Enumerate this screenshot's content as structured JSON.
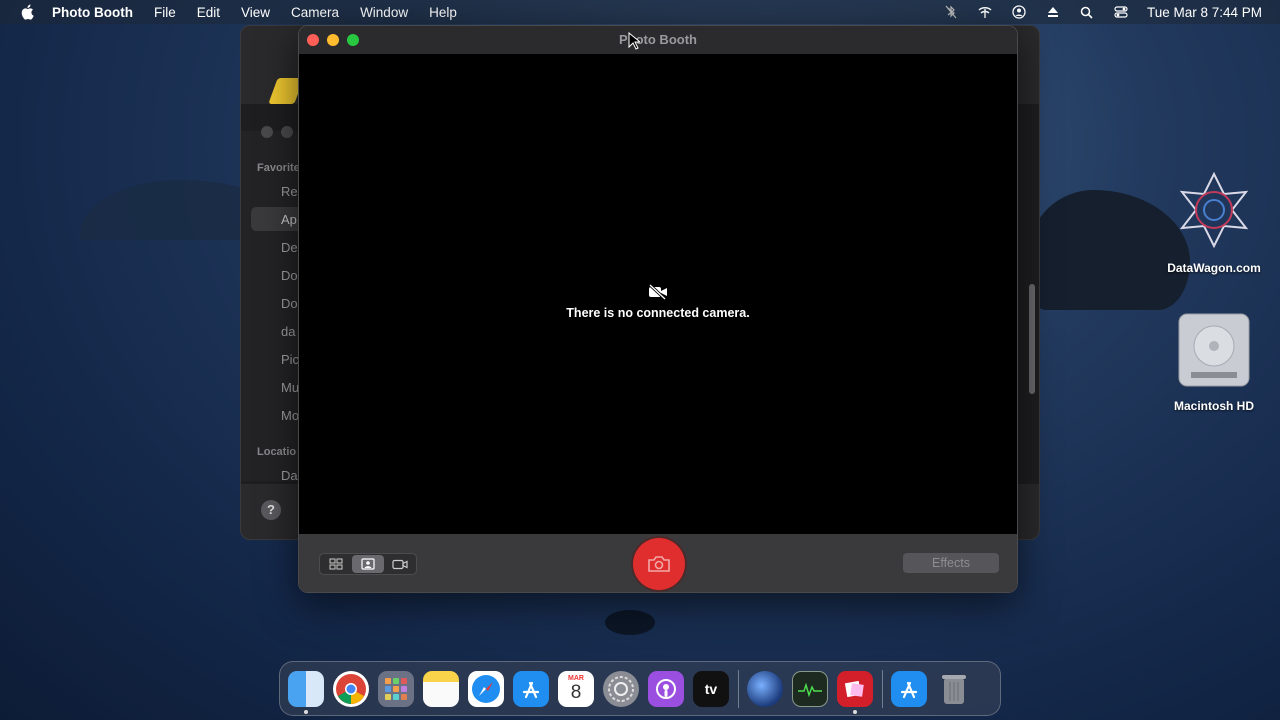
{
  "menubar": {
    "app_name": "Photo Booth",
    "items": [
      "File",
      "Edit",
      "View",
      "Camera",
      "Window",
      "Help"
    ],
    "clock": "Tue Mar 8  7:44 PM"
  },
  "finder_bg": {
    "sidebar_headers": [
      "Favorite",
      "Locatio"
    ],
    "sidebar_items": [
      "Re",
      "Ap",
      "De",
      "Do",
      "Do",
      "da",
      "Pic",
      "Mu",
      "Mo",
      "Da"
    ],
    "help_label": "?"
  },
  "photobooth": {
    "title": "Photo Booth",
    "no_camera_message": "There is no connected camera.",
    "effects_label": "Effects"
  },
  "desktop": {
    "icons": [
      {
        "label": "DataWagon.com"
      },
      {
        "label": "Macintosh HD"
      }
    ]
  },
  "dock": {
    "calendar_month": "MAR",
    "calendar_day": "8",
    "tv_label": "tv"
  },
  "colors": {
    "shutter": "#e02d2d",
    "close": "#ff5f57",
    "minimize": "#febc2e",
    "zoom": "#28c840"
  }
}
